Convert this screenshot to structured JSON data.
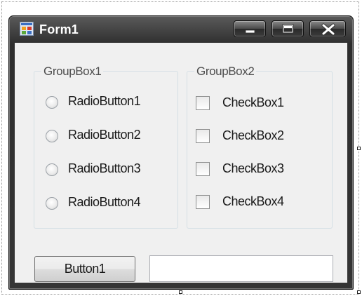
{
  "window": {
    "title": "Form1",
    "controls": {
      "minimize": "minimize-icon",
      "maximize": "maximize-icon",
      "close": "close-icon"
    }
  },
  "groupbox1": {
    "title": "GroupBox1",
    "options": [
      "RadioButton1",
      "RadioButton2",
      "RadioButton3",
      "RadioButton4"
    ],
    "selected": null
  },
  "groupbox2": {
    "title": "GroupBox2",
    "options": [
      "CheckBox1",
      "CheckBox2",
      "CheckBox3",
      "CheckBox4"
    ],
    "checked": [
      false,
      false,
      false,
      false
    ]
  },
  "button1": {
    "label": "Button1"
  },
  "textbox1": {
    "value": "",
    "placeholder": ""
  },
  "colors": {
    "titlebar": "#2e2e2e",
    "client": "#f0f0f0",
    "groupbox_border": "#d5dfe5"
  }
}
